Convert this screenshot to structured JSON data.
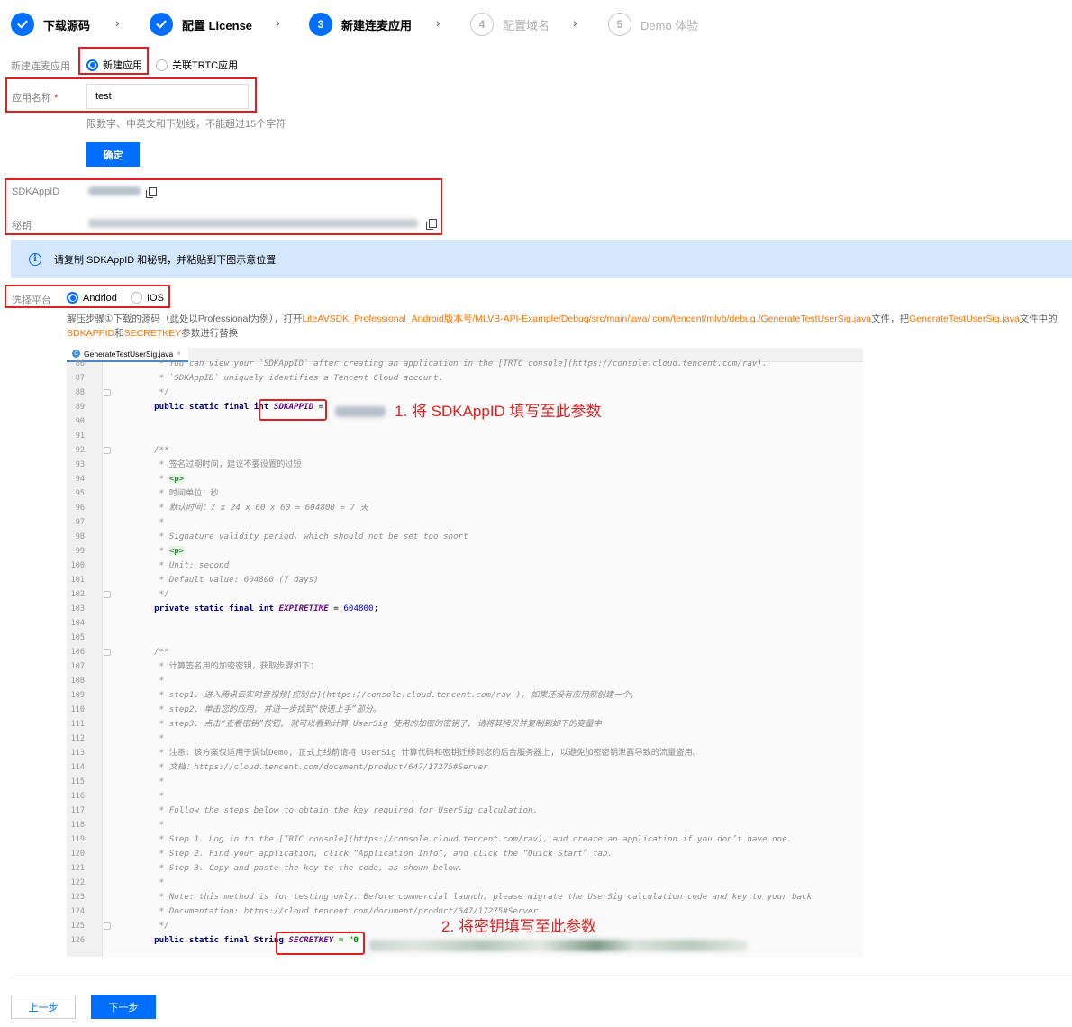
{
  "steps": [
    {
      "number": "1",
      "label": "下载源码",
      "state": "done"
    },
    {
      "number": "2",
      "label": "配置 License",
      "state": "done"
    },
    {
      "number": "3",
      "label": "新建连麦应用",
      "state": "active"
    },
    {
      "number": "4",
      "label": "配置域名",
      "state": "todo"
    },
    {
      "number": "5",
      "label": "Demo 体验",
      "state": "todo"
    }
  ],
  "create_app": {
    "label": "新建连麦应用",
    "options": [
      "新建应用",
      "关联TRTC应用"
    ],
    "selected": "新建应用"
  },
  "app_name": {
    "label": "应用名称",
    "required_mark": "*",
    "value": "test",
    "hint": "限数字、中英文和下划线，不能超过15个字符"
  },
  "confirm_button": "确定",
  "credentials": {
    "sdkappid_label": "SDKAppID",
    "secret_label": "秘钥"
  },
  "info_bar": {
    "icon": "info-icon",
    "text": "请复制 SDKAppID 和秘钥，并粘贴到下图示意位置"
  },
  "platform": {
    "label": "选择平台",
    "options": [
      "Andriod",
      "IOS"
    ],
    "selected": "Andriod"
  },
  "description": {
    "part1": "解压步骤①下载的源码（此处以Professional为例），打开",
    "path": "LiteAVSDK_Professional_Android版本号/MLVB-API-Example/Debug/src/main/java/ com/tencent/mlvb/debug./GenerateTestUserSig.java",
    "part2": "文件，把",
    "file": "GenerateTestUserSig.java",
    "part3": "文件中的",
    "param1": "SDKAPPID",
    "part4": "和",
    "param2": "SECRETKEY",
    "part5": "参数进行替换"
  },
  "code": {
    "tab_name": "GenerateTestUserSig.java",
    "annotation1": "1. 将 SDKAppID 填写至此参数",
    "annotation2": "2. 将密钥填写至此参数",
    "lines": [
      {
        "n": "86",
        "t": "     * You can view your `SDKAppID` after creating an application in the [TRTC console](https://console.cloud.tencent.com/rav).",
        "c": "c-comment"
      },
      {
        "n": "87",
        "t": "     * `SDKAppID` uniquely identifies a Tencent Cloud account.",
        "c": "c-comment"
      },
      {
        "n": "88",
        "t": "     */",
        "c": "c-comment"
      },
      {
        "n": "89",
        "t": "",
        "c": "sdkappid"
      },
      {
        "n": "90",
        "t": "",
        "c": "c-normal"
      },
      {
        "n": "91",
        "t": "",
        "c": "c-normal"
      },
      {
        "n": "92",
        "t": "    /**",
        "c": "c-comment"
      },
      {
        "n": "93",
        "t": "     * 签名过期时间，建议不要设置的过短",
        "c": "c-comment-cn"
      },
      {
        "n": "94",
        "t": "",
        "c": "ptag"
      },
      {
        "n": "95",
        "t": "     * 时间单位：秒",
        "c": "c-comment-cn"
      },
      {
        "n": "96",
        "t": "     * 默认时间：7 x 24 x 60 x 60 = 604800 = 7 天",
        "c": "c-comment"
      },
      {
        "n": "97",
        "t": "     *",
        "c": "c-comment"
      },
      {
        "n": "98",
        "t": "     * Signature validity period, which should not be set too short",
        "c": "c-comment"
      },
      {
        "n": "99",
        "t": "",
        "c": "ptag"
      },
      {
        "n": "100",
        "t": "     * Unit: second",
        "c": "c-comment"
      },
      {
        "n": "101",
        "t": "     * Default value: 604800 (7 days)",
        "c": "c-comment"
      },
      {
        "n": "102",
        "t": "     */",
        "c": "c-comment"
      },
      {
        "n": "103",
        "t": "",
        "c": "expire"
      },
      {
        "n": "104",
        "t": "",
        "c": "c-normal"
      },
      {
        "n": "105",
        "t": "",
        "c": "c-normal"
      },
      {
        "n": "106",
        "t": "    /**",
        "c": "c-comment"
      },
      {
        "n": "107",
        "t": "     * 计算签名用的加密密钥，获取步骤如下：",
        "c": "c-comment-cn"
      },
      {
        "n": "108",
        "t": "     *",
        "c": "c-comment"
      },
      {
        "n": "109",
        "t": "     * step1. 进入腾讯云实时音视频[控制台](https://console.cloud.tencent.com/rav ), 如果还没有应用就创建一个,",
        "c": "c-comment"
      },
      {
        "n": "110",
        "t": "     * step2. 单击您的应用, 并进一步找到“快速上手”部分。",
        "c": "c-comment"
      },
      {
        "n": "111",
        "t": "     * step3. 点击“查看密钥”按钮, 就可以看到计算 UserSig 使用的加密的密钥了, 请将其拷贝并复制到如下的变量中",
        "c": "c-comment"
      },
      {
        "n": "112",
        "t": "     *",
        "c": "c-comment"
      },
      {
        "n": "113",
        "t": "     * 注意：该方案仅适用于调试Demo, 正式上线前请将 UserSig 计算代码和密钥迁移到您的后台服务器上, 以避免加密密钥泄露导致的流量盗用。",
        "c": "c-comment-cn"
      },
      {
        "n": "114",
        "t": "     * 文档：https://cloud.tencent.com/document/product/647/17275#Server",
        "c": "c-comment"
      },
      {
        "n": "115",
        "t": "     *",
        "c": "c-comment"
      },
      {
        "n": "116",
        "t": "     *",
        "c": "c-comment"
      },
      {
        "n": "117",
        "t": "     * Follow the steps below to obtain the key required for UserSig calculation.",
        "c": "c-comment"
      },
      {
        "n": "118",
        "t": "     *",
        "c": "c-comment"
      },
      {
        "n": "119",
        "t": "     * Step 1. Log in to the [TRTC console](https://console.cloud.tencent.com/rav), and create an application if you don’t have one.",
        "c": "c-comment"
      },
      {
        "n": "120",
        "t": "     * Step 2. Find your application, click “Application Info”, and click the “Quick Start” tab.",
        "c": "c-comment"
      },
      {
        "n": "121",
        "t": "     * Step 3. Copy and paste the key to the code, as shown below.",
        "c": "c-comment"
      },
      {
        "n": "122",
        "t": "     *",
        "c": "c-comment"
      },
      {
        "n": "123",
        "t": "     * Note: this method is for testing only. Before commercial launch, please migrate the UserSig calculation code and key to your back",
        "c": "c-comment"
      },
      {
        "n": "124",
        "t": "     * Documentation: https://cloud.tencent.com/document/product/647/17275#Server",
        "c": "c-comment"
      },
      {
        "n": "125",
        "t": "     */",
        "c": "c-comment"
      },
      {
        "n": "126",
        "t": "",
        "c": "secret"
      }
    ],
    "sdkappid_line": {
      "kw": "public static final int ",
      "const": "SDKAPPID",
      "rest": " = "
    },
    "expire_line": {
      "kw": "private static final int ",
      "const": "EXPIRETIME",
      "mid": " = ",
      "num": "604800",
      "end": ";"
    },
    "secret_line": {
      "kw": "public static final String ",
      "const": "SECRETKEY",
      "rest": " = \"0"
    },
    "p_tag": "<p>"
  },
  "footer": {
    "prev_button": "上一步",
    "next_button": "下一步"
  },
  "colors": {
    "primary": "#006eff",
    "annotation_red": "#e02020",
    "info_bar_bg": "#d5e7fd",
    "highlight_orange": "#ff7200"
  }
}
